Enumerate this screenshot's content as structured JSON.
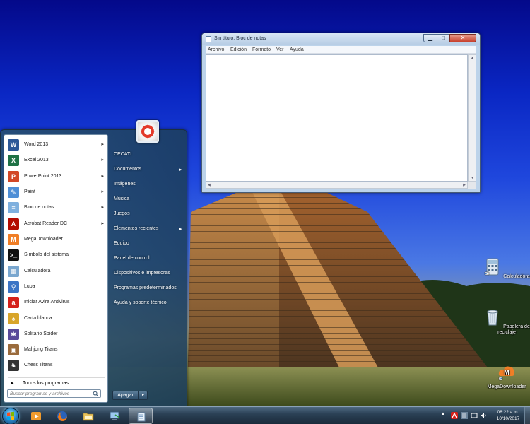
{
  "notepad": {
    "title": "Sin título: Bloc de notas",
    "menus": [
      "Archivo",
      "Edición",
      "Formato",
      "Ver",
      "Ayuda"
    ],
    "minimize_glyph": "▁",
    "maximize_glyph": "□",
    "close_glyph": "✕"
  },
  "desktop_icons": {
    "calculator": "Calculadora",
    "recycle_bin": "Papelera de reciclaje",
    "megadownloader": "MegaDownloader"
  },
  "start_menu": {
    "pinned": [
      {
        "label": "Word 2013",
        "icon": "word-icon",
        "color": "#2b5797",
        "glyph": "W",
        "submenu": true
      },
      {
        "label": "Excel 2013",
        "icon": "excel-icon",
        "color": "#1e7145",
        "glyph": "X",
        "submenu": true
      },
      {
        "label": "PowerPoint 2013",
        "icon": "powerpoint-icon",
        "color": "#d24726",
        "glyph": "P",
        "submenu": true
      },
      {
        "label": "Paint",
        "icon": "paint-icon",
        "color": "#4f8fd6",
        "glyph": "✎",
        "submenu": true
      },
      {
        "label": "Bloc de notas",
        "icon": "notepad-icon",
        "color": "#7fb0de",
        "glyph": "≡",
        "submenu": true
      },
      {
        "label": "Acrobat Reader DC",
        "icon": "acrobat-icon",
        "color": "#b30b00",
        "glyph": "A",
        "submenu": true
      }
    ],
    "recent": [
      {
        "label": "MegaDownloader",
        "icon": "megadownloader-icon",
        "color": "#f07e26",
        "glyph": "M"
      },
      {
        "label": "Símbolo del sistema",
        "icon": "cmd-icon",
        "color": "#111111",
        "glyph": ">_"
      },
      {
        "label": "Calculadora",
        "icon": "calculator-icon",
        "color": "#7aa7cf",
        "glyph": "▦"
      },
      {
        "label": "Lupa",
        "icon": "magnifier-icon",
        "color": "#3b74c5",
        "glyph": "⚲"
      },
      {
        "label": "Iniciar Avira Antivirus",
        "icon": "avira-icon",
        "color": "#d4201a",
        "glyph": "a"
      },
      {
        "label": "Carta blanca",
        "icon": "freecell-icon",
        "color": "#d8a52a",
        "glyph": "♠"
      },
      {
        "label": "Solitario Spider",
        "icon": "spider-icon",
        "color": "#5a4a9a",
        "glyph": "✱"
      },
      {
        "label": "Mahjong Titans",
        "icon": "mahjong-icon",
        "color": "#9a6b3c",
        "glyph": "▣"
      },
      {
        "label": "Chess Titans",
        "icon": "chess-icon",
        "color": "#333333",
        "glyph": "♞"
      }
    ],
    "all_programs": "Todos los programas",
    "search_placeholder": "Buscar programas y archivos",
    "right": [
      {
        "label": "CECATI",
        "submenu": false
      },
      {
        "label": "Documentos",
        "submenu": true
      },
      {
        "label": "Imágenes",
        "submenu": false
      },
      {
        "label": "Música",
        "submenu": false
      },
      {
        "label": "Juegos",
        "submenu": false
      },
      {
        "label": "Elementos recientes",
        "submenu": true
      },
      {
        "label": "Equipo",
        "submenu": false
      },
      {
        "label": "Panel de control",
        "submenu": false
      },
      {
        "label": "Dispositivos e impresoras",
        "submenu": false
      },
      {
        "label": "Programas predeterminados",
        "submenu": false
      },
      {
        "label": "Ayuda y soporte técnico",
        "submenu": false
      }
    ],
    "shutdown": "Apagar",
    "shutdown_arrow": "▸",
    "submenu_arrow": "▸"
  },
  "taskbar": {
    "time": "08:22 a.m.",
    "date": "10/10/2017",
    "tray_up_arrow": "▲"
  }
}
